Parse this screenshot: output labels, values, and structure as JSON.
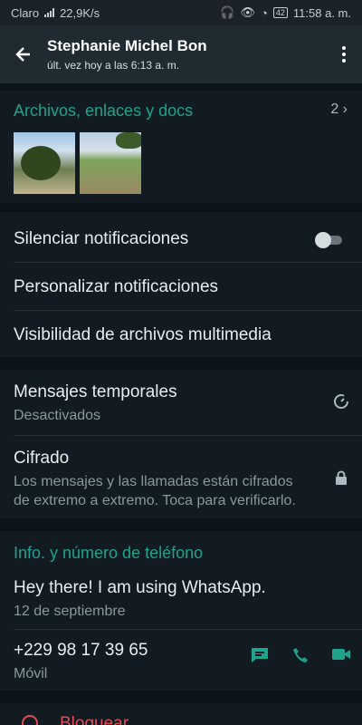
{
  "status_bar": {
    "carrier": "Claro",
    "speed": "22,9K/s",
    "battery": "42",
    "time": "11:58 a. m."
  },
  "header": {
    "name": "Stephanie Michel Bon",
    "last_seen": "últ. vez hoy a las 6:13 a. m."
  },
  "media": {
    "title": "Archivos, enlaces y docs",
    "count": "2"
  },
  "notifications": {
    "mute_label": "Silenciar notificaciones",
    "mute_enabled": false,
    "custom_label": "Personalizar notificaciones",
    "media_visibility_label": "Visibilidad de archivos multimedia"
  },
  "privacy": {
    "temporary_label": "Mensajes temporales",
    "temporary_value": "Desactivados",
    "encryption_label": "Cifrado",
    "encryption_desc_1": "Los mensajes y las llamadas están cifrados",
    "encryption_desc_2": "de extremo a extremo. Toca para verificarlo."
  },
  "info": {
    "title": "Info. y número de teléfono",
    "about": "Hey there! I am using WhatsApp.",
    "about_date": "12 de septiembre",
    "phone": "+229 98 17 39 65",
    "phone_type": "Móvil"
  },
  "block": {
    "label": "Bloquear"
  },
  "colors": {
    "accent": "#1fa38c",
    "danger": "#e24c5a",
    "background": "#0b141a",
    "section": "#111b21"
  }
}
